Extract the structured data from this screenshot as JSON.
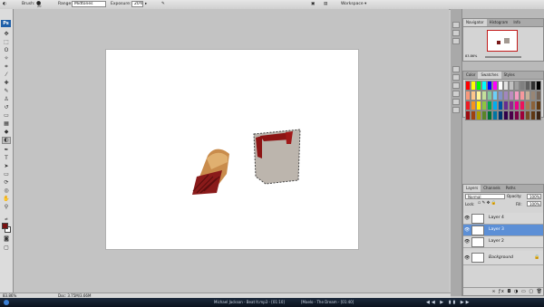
{
  "options_bar": {
    "brush_label": "Brush:",
    "brush_size": "20",
    "range_label": "Range:",
    "range_value": "Midtones",
    "exposure_label": "Exposure:",
    "exposure_value": "20%",
    "workspace_label": "Workspace ▾"
  },
  "toolbox": {
    "logo": "Ps"
  },
  "status_bar": {
    "zoom": "83.86%",
    "doc_info": "Doc: 3.75M/3.66M"
  },
  "navigator_panel": {
    "tabs": [
      "Navigator",
      "Histogram",
      "Info"
    ],
    "active_tab": 0,
    "zoom_value": "83.86%"
  },
  "swatches_panel": {
    "tabs": [
      "Color",
      "Swatches",
      "Styles"
    ],
    "active_tab": 1
  },
  "layers_panel": {
    "tabs": [
      "Layers",
      "Channels",
      "Paths"
    ],
    "active_tab": 0,
    "blend_mode": "Normal",
    "opacity_label": "Opacity:",
    "opacity_value": "100%",
    "lock_label": "Lock:",
    "fill_label": "Fill:",
    "fill_value": "100%",
    "layers": [
      {
        "name": "Layer 4",
        "selected": false
      },
      {
        "name": "Layer 3",
        "selected": true
      },
      {
        "name": "Layer 2",
        "selected": false
      },
      {
        "name": "Background",
        "selected": false
      }
    ]
  },
  "taskbar": {
    "items": [
      "Michael Jackson - Beat It.mp3 - [01:10]",
      "[Maelo - The Dream - [01:40]"
    ]
  },
  "colors": {
    "foreground": "#7a1010",
    "background": "#ffffff",
    "selection": "#5c8fd6"
  }
}
